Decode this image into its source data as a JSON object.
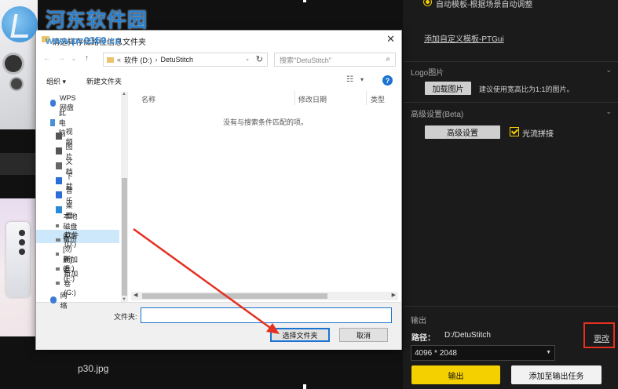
{
  "watermark": {
    "title": "河东软件园",
    "url": "www.pc0359.cn"
  },
  "gallery": {
    "filename": "p30.jpg"
  },
  "dialog": {
    "title": "请选择存储路径信息文件夹",
    "nav": {
      "back": "←",
      "forward": "→",
      "up": "↑"
    },
    "address": {
      "prefix": "«",
      "drive": "软件 (D:)",
      "sep": "›",
      "folder": "DetuStitch"
    },
    "search_placeholder": "搜索\"DetuStitch\"",
    "toolbar": {
      "organize": "组织 ▾",
      "new_folder": "新建文件夹",
      "help": "?"
    },
    "nav_items": [
      {
        "label": "WPS网盘",
        "icon": "cloud-icon"
      },
      {
        "label": "此电脑",
        "icon": "computer-icon"
      },
      {
        "label": "视频",
        "icon": "video-icon"
      },
      {
        "label": "图片",
        "icon": "picture-icon"
      },
      {
        "label": "文档",
        "icon": "document-icon"
      },
      {
        "label": "下载",
        "icon": "download-icon"
      },
      {
        "label": "音乐",
        "icon": "music-icon"
      },
      {
        "label": "桌面",
        "icon": "desktop-icon"
      },
      {
        "label": "本地磁盘 (C:)",
        "icon": "drive-icon"
      },
      {
        "label": "软件 (D:)",
        "icon": "drive-icon"
      },
      {
        "label": "备份[勿删] (E:)",
        "icon": "drive-icon"
      },
      {
        "label": "新加卷 (F:)",
        "icon": "drive-icon"
      },
      {
        "label": "新加卷 (G:)",
        "icon": "drive-icon"
      },
      {
        "label": "网络",
        "icon": "network-icon"
      }
    ],
    "columns": {
      "name": "名称",
      "modified": "修改日期",
      "type": "类型"
    },
    "empty_message": "没有与搜索条件匹配的项。",
    "folder_label": "文件夹:",
    "folder_value": "",
    "select_button": "选择文件夹",
    "cancel_button": "取消"
  },
  "panel": {
    "radio_label": "自动模板-根据场景自动调整",
    "custom_template_link": "添加自定义模板-PTGui",
    "logo": {
      "header": "Logo图片",
      "load_button": "加载图片",
      "hint": "建议使用宽高比为1:1的图片。"
    },
    "advanced": {
      "header": "高级设置(Beta)",
      "button": "高级设置",
      "optical_flow_label": "光流拼接",
      "optical_flow_checked": true
    },
    "output": {
      "header": "输出",
      "path_label": "路径：",
      "path_value": "D:/DetuStitch",
      "change_link": "更改",
      "resolution": "4096 * 2048",
      "output_button": "输出",
      "add_task_button": "添加至输出任务"
    },
    "accent_color": "#f5d000",
    "highlight_color": "#e53020"
  }
}
